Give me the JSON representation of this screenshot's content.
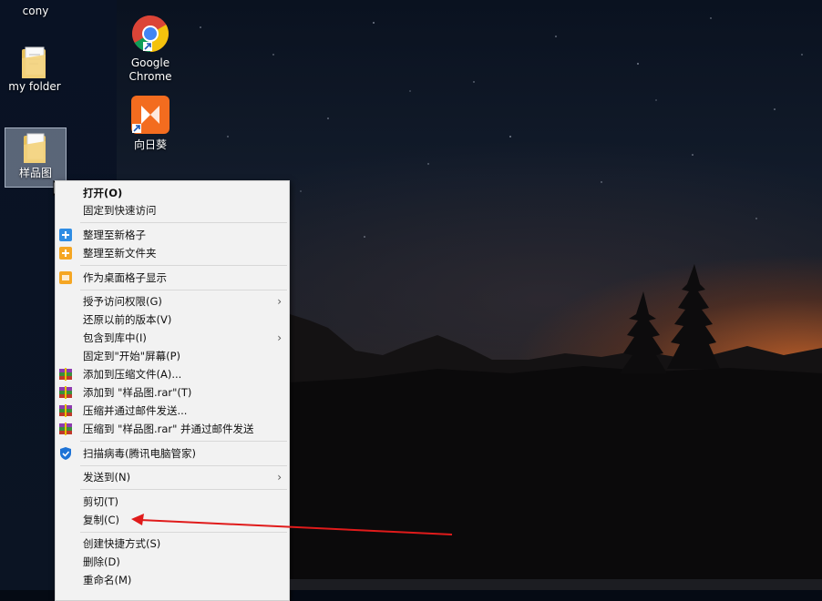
{
  "desktop": {
    "icons": [
      {
        "label": "cony"
      },
      {
        "label": "my folder"
      },
      {
        "label": "样品图"
      },
      {
        "label_line1": "Google",
        "label_line2": "Chrome"
      },
      {
        "label": "向日葵"
      }
    ]
  },
  "context_menu": {
    "open": "打开(O)",
    "pin_quick_access": "固定到快速访问",
    "organize_new_grid": "整理至新格子",
    "organize_new_folder": "整理至新文件夹",
    "show_as_desktop_grid": "作为桌面格子显示",
    "grant_access": "授予访问权限(G)",
    "restore_versions": "还原以前的版本(V)",
    "include_in_library": "包含到库中(I)",
    "pin_to_start": "固定到\"开始\"屏幕(P)",
    "add_to_archive": "添加到压缩文件(A)...",
    "add_to_rar": "添加到 \"样品图.rar\"(T)",
    "compress_email": "压缩并通过邮件发送...",
    "compress_rar_email": "压缩到 \"样品图.rar\" 并通过邮件发送",
    "scan_virus": "扫描病毒(腾讯电脑管家)",
    "send_to": "发送到(N)",
    "cut": "剪切(T)",
    "copy": "复制(C)",
    "create_shortcut": "创建快捷方式(S)",
    "delete": "删除(D)",
    "rename": "重命名(M)"
  },
  "colors": {
    "annotation_arrow": "#e01b1b",
    "menu_bg": "#f2f2f2",
    "organize_icon_blue": "#2f8de4",
    "organize_icon_orange": "#f5a623",
    "shield_blue": "#1e73d6"
  }
}
